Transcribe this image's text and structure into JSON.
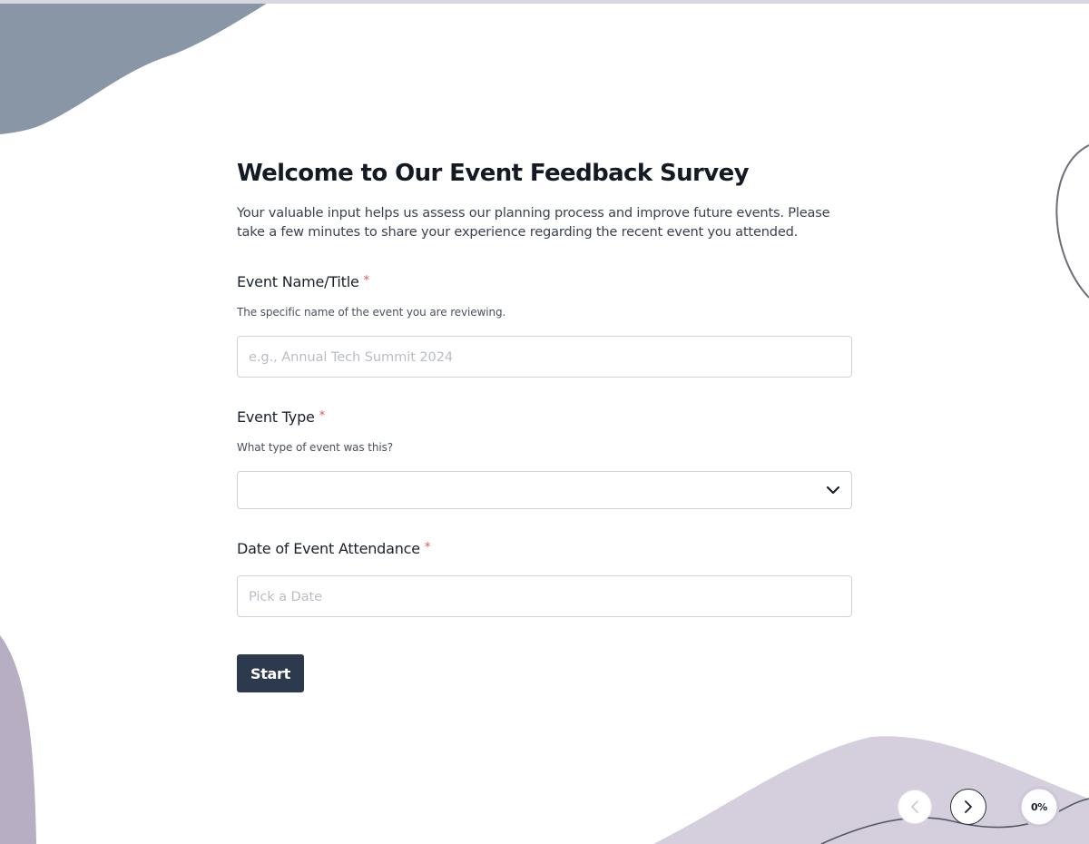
{
  "survey": {
    "title": "Welcome to Our Event Feedback Survey",
    "intro": "Your valuable input helps us assess our planning process and improve future events. Please take a few minutes to share your experience regarding the recent event you attended."
  },
  "fields": {
    "event_name": {
      "label": "Event Name/Title",
      "required_mark": "*",
      "description": "The specific name of the event you are reviewing.",
      "placeholder": "e.g., Annual Tech Summit 2024",
      "value": ""
    },
    "event_type": {
      "label": "Event Type",
      "required_mark": "*",
      "description": "What type of event was this?",
      "selected": "",
      "icon": "chevron-down-icon"
    },
    "event_date": {
      "label": "Date of Event Attendance",
      "required_mark": "*",
      "placeholder": "Pick a Date",
      "value": ""
    }
  },
  "actions": {
    "start_label": "Start"
  },
  "navigation": {
    "prev_icon": "chevron-left-icon",
    "next_icon": "chevron-right-icon",
    "progress_label": "0%",
    "progress_value": 0
  },
  "colors": {
    "button_bg": "#2d3a4d",
    "required": "#e05555",
    "blob_slate": "#8795a5",
    "blob_lavender": "#d3ccdb"
  }
}
